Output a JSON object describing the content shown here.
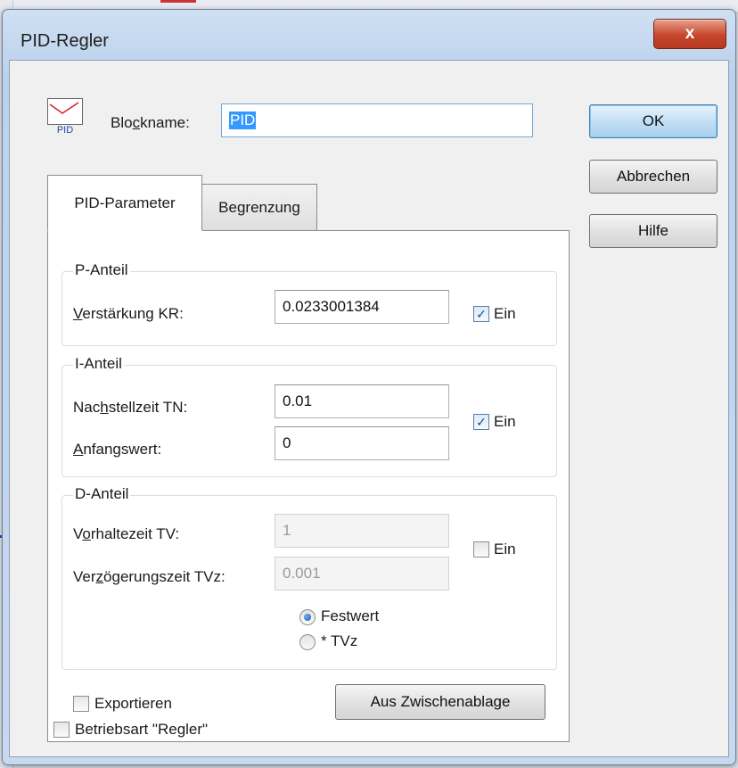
{
  "window": {
    "title": "PID-Regler",
    "close_glyph": "x"
  },
  "block": {
    "icon_label": "PID",
    "name_label_pre": "Blo",
    "name_label_accel": "c",
    "name_label_post": "kname:",
    "name_value": "PID"
  },
  "buttons": {
    "ok": "OK",
    "cancel": "Abbrechen",
    "help": "Hilfe",
    "clipboard": "Aus Zwischenablage"
  },
  "tabs": [
    {
      "label": "PID-Parameter",
      "active": true
    },
    {
      "label": "Begrenzung",
      "active": false
    }
  ],
  "p_group": {
    "title": "P-Anteil",
    "gain_label_accel": "V",
    "gain_label_rest": "erstärkung KR:",
    "gain_value": "0.0233001384",
    "enable_label": "Ein",
    "enabled": true
  },
  "i_group": {
    "title": "I-Anteil",
    "reset_label_pre": "Nac",
    "reset_label_accel": "h",
    "reset_label_post": "stellzeit TN:",
    "reset_value": "0.01",
    "init_label_accel": "A",
    "init_label_rest": "nfangswert:",
    "init_value": "0",
    "enable_label": "Ein",
    "enabled": true
  },
  "d_group": {
    "title": "D-Anteil",
    "lead_label_pre": "V",
    "lead_label_accel": "o",
    "lead_label_post": "rhaltezeit TV:",
    "lead_value": "1",
    "delay_label_pre": "Ver",
    "delay_label_accel": "z",
    "delay_label_post": "ögerungszeit TVz:",
    "delay_value": "0.001",
    "enable_label": "Ein",
    "enabled": false,
    "radio_fixed": "Festwert",
    "radio_tvz": "* TVz",
    "selected": "Festwert"
  },
  "export": {
    "label": "Exportieren",
    "checked": false
  },
  "mode": {
    "label": "Betriebsart \"Regler\"",
    "checked": false
  },
  "colors": {
    "title_bar": "#bcd2ec",
    "close_button": "#c7462c",
    "selection": "#3399ff",
    "check": "#1c4f86"
  }
}
